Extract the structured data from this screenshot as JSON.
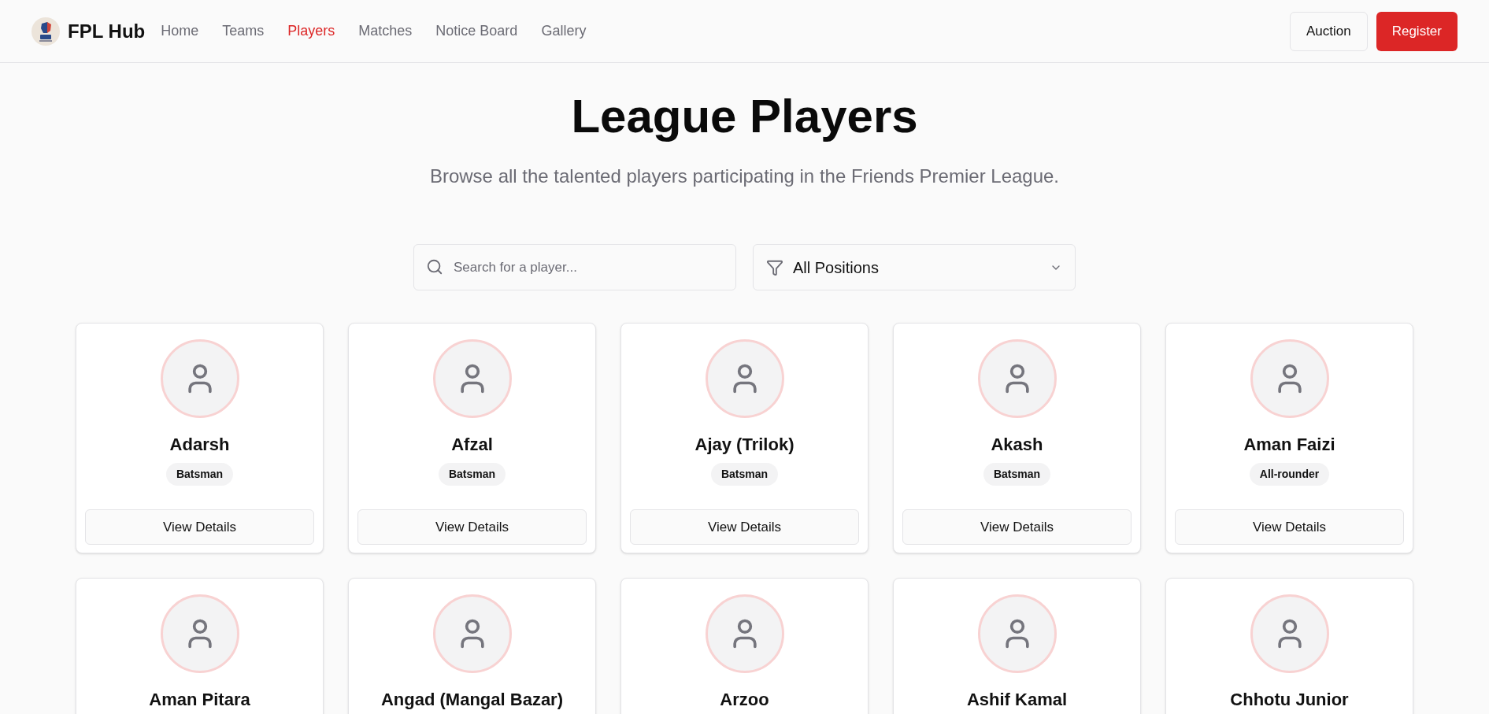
{
  "header": {
    "brand": "FPL Hub",
    "nav": [
      {
        "label": "Home",
        "selected": false
      },
      {
        "label": "Teams",
        "selected": false
      },
      {
        "label": "Players",
        "selected": true
      },
      {
        "label": "Matches",
        "selected": false
      },
      {
        "label": "Notice Board",
        "selected": false
      },
      {
        "label": "Gallery",
        "selected": false
      }
    ],
    "buttons": [
      {
        "label": "Auction",
        "kind": "outline"
      },
      {
        "label": "Register",
        "kind": "primary"
      }
    ]
  },
  "page": {
    "title": "League Players",
    "subtitle": "Browse all the talented players participating in the Friends Premier League."
  },
  "search": {
    "placeholder": "Search for a player..."
  },
  "filter": {
    "value": "All Positions"
  },
  "players": [
    {
      "name": "Adarsh",
      "position": "Batsman",
      "action": "View Details"
    },
    {
      "name": "Afzal",
      "position": "Batsman",
      "action": "View Details"
    },
    {
      "name": "Ajay (Trilok)",
      "position": "Batsman",
      "action": "View Details"
    },
    {
      "name": "Akash",
      "position": "Batsman",
      "action": "View Details"
    },
    {
      "name": "Aman Faizi",
      "position": "All-rounder",
      "action": "View Details"
    },
    {
      "name": "Aman Pitara"
    },
    {
      "name": "Angad (Mangal Bazar)"
    },
    {
      "name": "Arzoo"
    },
    {
      "name": "Ashif Kamal"
    },
    {
      "name": "Chhotu Junior"
    }
  ]
}
